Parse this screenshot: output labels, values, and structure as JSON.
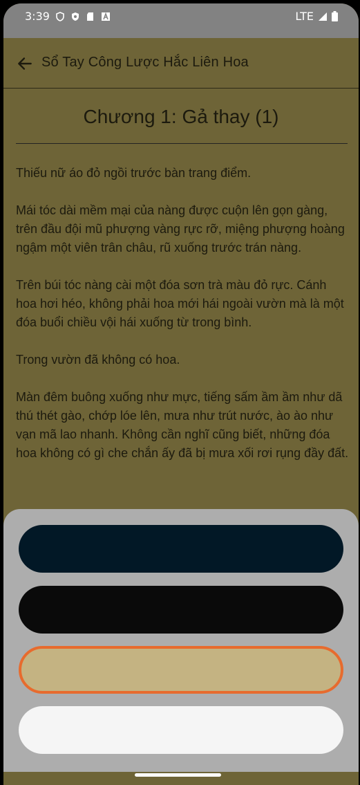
{
  "status_bar": {
    "time": "3:39",
    "network": "LTE",
    "icons": [
      "shield-icon",
      "shield-filled-icon",
      "sd-card-icon",
      "font-a-icon",
      "signal-icon",
      "battery-icon"
    ]
  },
  "app_bar": {
    "title": "Sổ Tay Công Lược Hắc Liên Hoa",
    "back_icon": "arrow-back-icon"
  },
  "chapter": {
    "title": "Chương 1: Gả thay (1)",
    "paragraphs": [
      "Thiếu nữ áo đỏ ngồi trước bàn trang điểm.",
      "Mái tóc dài mềm mại của nàng được cuộn lên gọn gàng, trên đầu đội mũ phượng vàng rực rỡ, miệng phượng hoàng ngậm một viên trân châu, rũ xuống trước trán nàng.",
      "Trên búi tóc nàng cài một đóa sơn trà màu đỏ rực. Cánh hoa hơi héo, không phải hoa mới hái ngoài vườn mà là một đóa buổi chiều vội hái xuống từ trong bình.",
      "Trong vườn đã không có hoa.",
      "Màn đêm buông xuống như mực, tiếng sấm ầm ầm như dã thú thét gào, chớp lóe lên, mưa như trút nước, ào ào như vạn mã lao nhanh. Không cần nghĩ cũng biết, những đóa hoa không có gì che chắn ấy đã bị mưa xối rơi rụng đầy đất."
    ]
  },
  "theme_sheet": {
    "options": [
      {
        "name": "theme-dark-navy",
        "color": "#021826",
        "selected": false
      },
      {
        "name": "theme-black",
        "color": "#0a0a0a",
        "selected": false
      },
      {
        "name": "theme-sepia",
        "color": "#c4b382",
        "selected": true,
        "border_color": "#e76b2e"
      },
      {
        "name": "theme-white",
        "color": "#f5f5f5",
        "selected": false
      }
    ]
  }
}
